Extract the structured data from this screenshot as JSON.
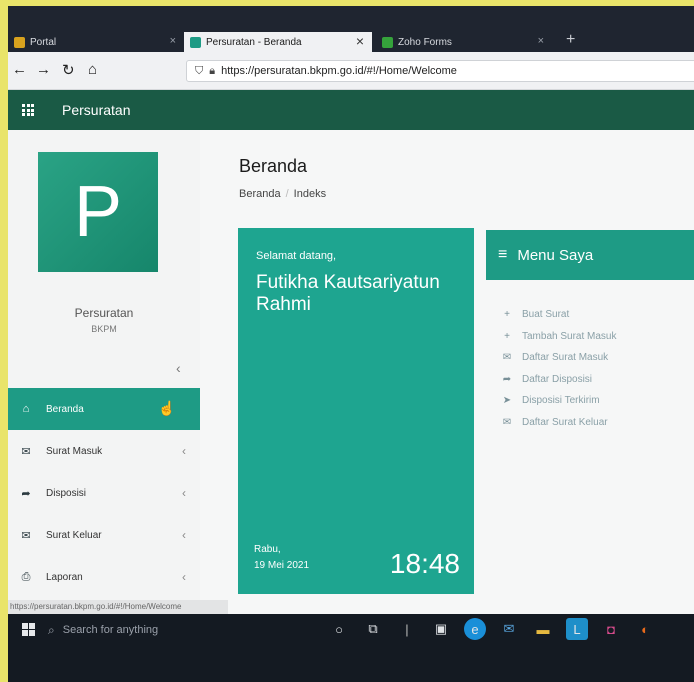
{
  "browser": {
    "tabs": [
      {
        "label": "Portal",
        "fav_color": "#d8a21e",
        "close": "×"
      },
      {
        "label": "Persuratan - Beranda",
        "fav_color": "#1e9b85",
        "close": "×"
      },
      {
        "label": "Zoho Forms",
        "fav_color": "#35a33b",
        "close": "×"
      }
    ],
    "new_tab": "+",
    "url": "https://persuratan.bkpm.go.id/#!/Home/Welcome"
  },
  "app": {
    "title": "Persuratan",
    "logo_letter": "P",
    "org_name": "Persuratan",
    "org_sub": "BKPM",
    "collapse": "‹"
  },
  "sidebar": {
    "items": [
      {
        "label": "Beranda",
        "icon": "home-icon",
        "glyph": "⌂",
        "active": true
      },
      {
        "label": "Surat Masuk",
        "icon": "inbox-icon",
        "glyph": "✉",
        "active": false
      },
      {
        "label": "Disposisi",
        "icon": "share-icon",
        "glyph": "➦",
        "active": false
      },
      {
        "label": "Surat Keluar",
        "icon": "outbox-icon",
        "glyph": "✉",
        "active": false
      },
      {
        "label": "Laporan",
        "icon": "print-icon",
        "glyph": "⎙",
        "active": false
      }
    ],
    "chevron": "‹"
  },
  "main": {
    "page_title": "Beranda",
    "breadcrumb": [
      "Beranda",
      "Indeks"
    ]
  },
  "welcome": {
    "greeting": "Selamat datang,",
    "name": "Futikha Kautsariyatun Rahmi",
    "day": "Rabu,",
    "date": "19 Mei 2021",
    "time": "18:48"
  },
  "menu": {
    "title": "Menu Saya",
    "items": [
      {
        "label": "Buat Surat",
        "icon": "plus-icon",
        "glyph": "+"
      },
      {
        "label": "Tambah Surat Masuk",
        "icon": "plus-icon",
        "glyph": "+"
      },
      {
        "label": "Daftar Surat Masuk",
        "icon": "inbox-icon",
        "glyph": "✉"
      },
      {
        "label": "Daftar Disposisi",
        "icon": "share-icon",
        "glyph": "➦"
      },
      {
        "label": "Disposisi Terkirim",
        "icon": "send-icon",
        "glyph": "➤"
      },
      {
        "label": "Daftar Surat Keluar",
        "icon": "outbox-icon",
        "glyph": "✉"
      }
    ]
  },
  "status_url": "https://persuratan.bkpm.go.id/#!/Home/Welcome",
  "taskbar": {
    "search_placeholder": "Search for anything"
  },
  "colors": {
    "app_header": "#1a5a45",
    "accent": "#1e9b85",
    "welcome_tile": "#1ea590"
  }
}
